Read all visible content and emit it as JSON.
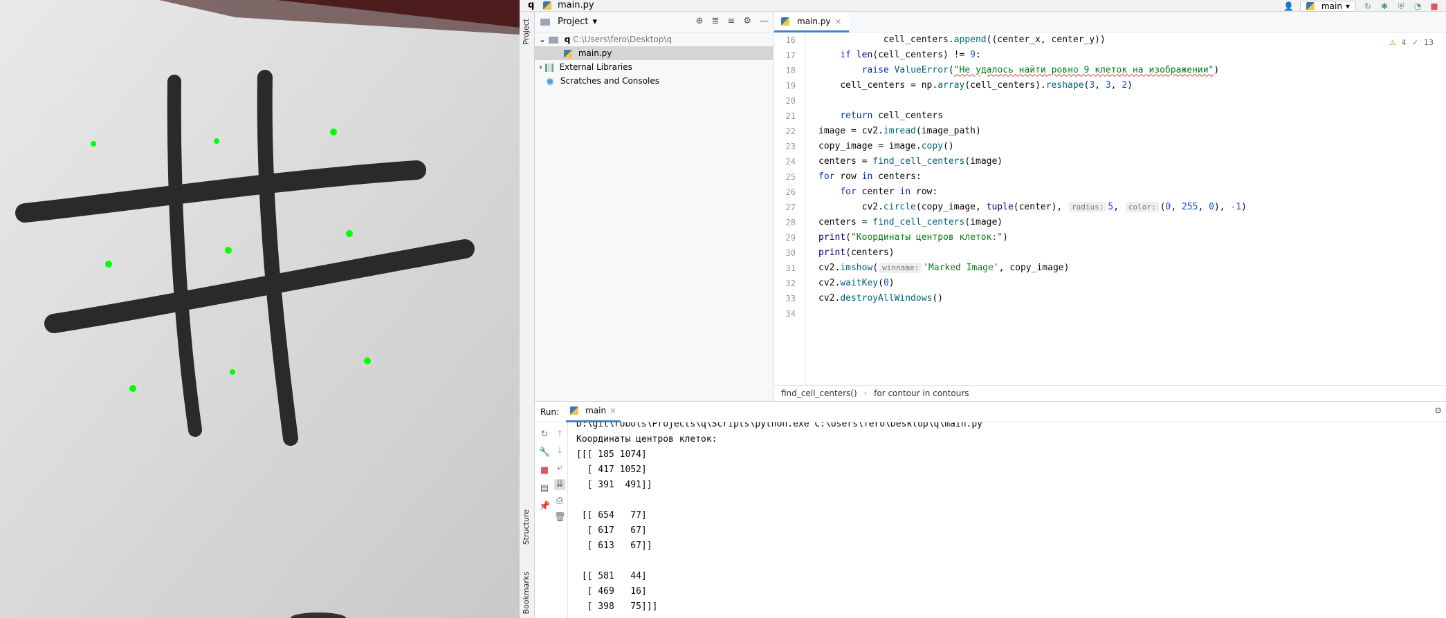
{
  "viewer": {
    "title": "Marked Image",
    "green_markers": 9
  },
  "topbar": {
    "project_letter": "q",
    "file_name": "main.py",
    "branch_label": "main"
  },
  "sidebar": {
    "project_tab": "Project",
    "structure_tab": "Structure",
    "bookmarks_tab": "Bookmarks"
  },
  "project": {
    "header_label": "Project",
    "tree": [
      {
        "name": "q",
        "path": "C:\\Users\\fero\\Desktop\\q"
      },
      {
        "name": "main.py"
      },
      {
        "name": "External Libraries"
      },
      {
        "name": "Scratches and Consoles"
      }
    ]
  },
  "editor": {
    "tab_label": "main.py",
    "inspections": {
      "warnings": "4",
      "ok": "13"
    },
    "line_numbers": [
      "16",
      "17",
      "18",
      "19",
      "20",
      "21",
      "22",
      "23",
      "24",
      "25",
      "26",
      "27",
      "28",
      "29",
      "30",
      "31",
      "32",
      "33",
      "34"
    ],
    "breadcrumb": {
      "function": "find_cell_centers()",
      "loop": "for contour in contours"
    },
    "strings": {
      "error_msg": "\"Не удалось найти ровно 9 клеток на изображении\"",
      "coords_msg": "\"Координаты центров клеток:\"",
      "window_name": "'Marked Image'"
    },
    "hints": {
      "radius": "radius:",
      "color": "color:",
      "winname": "winname:"
    }
  },
  "run": {
    "label": "Run:",
    "tab_label": "main",
    "console_lines": [
      "D:\\git\\robots\\Projects\\q\\Scripts\\python.exe C:\\Users\\fero\\Desktop\\q\\main.py",
      "Координаты центров клеток:",
      "[[[ 185 1074]",
      "  [ 417 1052]",
      "  [ 391  491]]",
      "",
      " [[ 654   77]",
      "  [ 617   67]",
      "  [ 613   67]]",
      "",
      " [[ 581   44]",
      "  [ 469   16]",
      "  [ 398   75]]]"
    ]
  },
  "colors": {
    "accent": "#4083c9",
    "marker": "#00ff00"
  }
}
